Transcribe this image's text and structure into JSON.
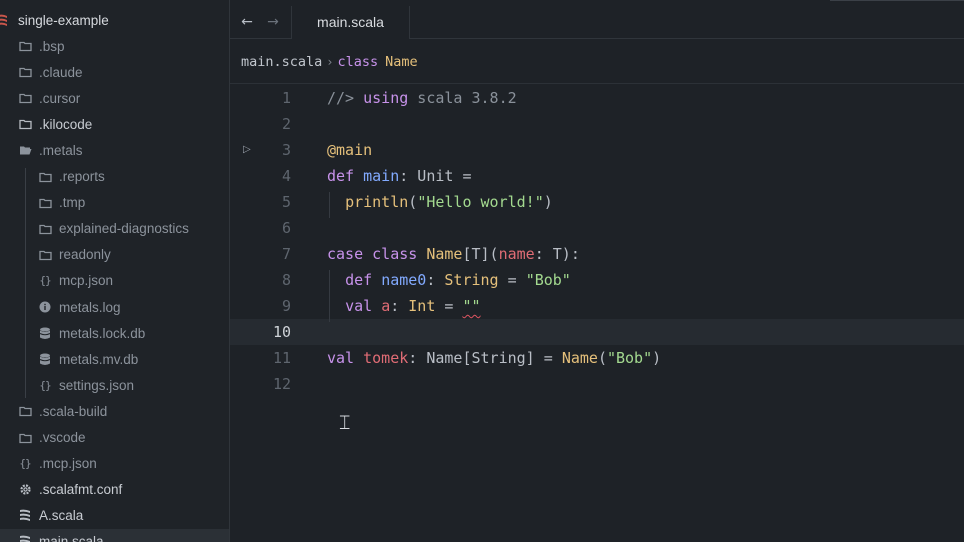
{
  "sidebar": {
    "project": "single-example",
    "items": [
      {
        "label": ".bsp",
        "icon": "folder-icon",
        "level": 1,
        "dim": true
      },
      {
        "label": ".claude",
        "icon": "folder-icon",
        "level": 1,
        "dim": true
      },
      {
        "label": ".cursor",
        "icon": "folder-icon",
        "level": 1,
        "dim": true
      },
      {
        "label": ".kilocode",
        "icon": "folder-icon",
        "level": 1,
        "dim": false
      },
      {
        "label": ".metals",
        "icon": "folder-open-icon",
        "level": 1,
        "dim": true
      },
      {
        "label": ".reports",
        "icon": "folder-icon",
        "level": 2,
        "dim": true
      },
      {
        "label": ".tmp",
        "icon": "folder-icon",
        "level": 2,
        "dim": true
      },
      {
        "label": "explained-diagnostics",
        "icon": "folder-icon",
        "level": 2,
        "dim": true
      },
      {
        "label": "readonly",
        "icon": "folder-icon",
        "level": 2,
        "dim": true
      },
      {
        "label": "mcp.json",
        "icon": "json-icon",
        "level": 2,
        "dim": true
      },
      {
        "label": "metals.log",
        "icon": "info-icon",
        "level": 2,
        "dim": true
      },
      {
        "label": "metals.lock.db",
        "icon": "database-icon",
        "level": 2,
        "dim": true
      },
      {
        "label": "metals.mv.db",
        "icon": "database-icon",
        "level": 2,
        "dim": true
      },
      {
        "label": "settings.json",
        "icon": "json-icon",
        "level": 2,
        "dim": true
      },
      {
        "label": ".scala-build",
        "icon": "folder-icon",
        "level": 1,
        "dim": true
      },
      {
        "label": ".vscode",
        "icon": "folder-icon",
        "level": 1,
        "dim": true
      },
      {
        "label": ".mcp.json",
        "icon": "json-icon",
        "level": 1,
        "dim": true
      },
      {
        "label": ".scalafmt.conf",
        "icon": "gear-icon",
        "level": 1,
        "dim": false
      },
      {
        "label": "A.scala",
        "icon": "scala-icon",
        "level": 1,
        "dim": false
      },
      {
        "label": "main.scala",
        "icon": "scala-icon",
        "level": 1,
        "dim": false,
        "active": true
      }
    ]
  },
  "tabs": [
    {
      "label": "main.scala",
      "active": true
    }
  ],
  "nav": {
    "back": "←",
    "forward": "→"
  },
  "breadcrumb": {
    "file": "main.scala",
    "separator": "›",
    "kind": "class",
    "symbol": "Name"
  },
  "editor": {
    "current_line": 10,
    "lines": [
      {
        "n": "1",
        "tokens": [
          {
            "t": "//> ",
            "c": "cm"
          },
          {
            "t": "using",
            "c": "kw"
          },
          {
            "t": " scala 3.8.2",
            "c": "cm"
          }
        ]
      },
      {
        "n": "2",
        "tokens": []
      },
      {
        "n": "3",
        "run": "▷",
        "tokens": [
          {
            "t": "@main",
            "c": "an"
          }
        ]
      },
      {
        "n": "4",
        "tokens": [
          {
            "t": "def",
            "c": "kw"
          },
          {
            "t": " "
          },
          {
            "t": "main",
            "c": "fn"
          },
          {
            "t": ": Unit ="
          }
        ]
      },
      {
        "n": "5",
        "tokens": [
          {
            "t": "  "
          },
          {
            "t": "println",
            "c": "ty"
          },
          {
            "t": "("
          },
          {
            "t": "\"Hello world!\"",
            "c": "st"
          },
          {
            "t": ")"
          }
        ]
      },
      {
        "n": "6",
        "tokens": []
      },
      {
        "n": "7",
        "tokens": [
          {
            "t": "case",
            "c": "kw"
          },
          {
            "t": " "
          },
          {
            "t": "class",
            "c": "kw"
          },
          {
            "t": " "
          },
          {
            "t": "Name",
            "c": "ty"
          },
          {
            "t": "[T]("
          },
          {
            "t": "name",
            "c": "pm"
          },
          {
            "t": ": T):"
          }
        ]
      },
      {
        "n": "8",
        "tokens": [
          {
            "t": "  "
          },
          {
            "t": "def",
            "c": "kw"
          },
          {
            "t": " "
          },
          {
            "t": "name0",
            "c": "fn"
          },
          {
            "t": ": "
          },
          {
            "t": "String",
            "c": "ty"
          },
          {
            "t": " = "
          },
          {
            "t": "\"Bob\"",
            "c": "st"
          }
        ]
      },
      {
        "n": "9",
        "tokens": [
          {
            "t": "  "
          },
          {
            "t": "val",
            "c": "kw"
          },
          {
            "t": " "
          },
          {
            "t": "a",
            "c": "pm"
          },
          {
            "t": ": "
          },
          {
            "t": "Int",
            "c": "ty"
          },
          {
            "t": " = "
          },
          {
            "t": "\"\"",
            "c": "st err"
          }
        ]
      },
      {
        "n": "10",
        "tokens": []
      },
      {
        "n": "11",
        "tokens": [
          {
            "t": "val",
            "c": "kw"
          },
          {
            "t": " "
          },
          {
            "t": "tomek",
            "c": "pm"
          },
          {
            "t": ": Name[String] = "
          },
          {
            "t": "Name",
            "c": "ty"
          },
          {
            "t": "("
          },
          {
            "t": "\"Bob\"",
            "c": "st"
          },
          {
            "t": ")"
          }
        ]
      },
      {
        "n": "12",
        "tokens": []
      }
    ]
  },
  "colors": {
    "background": "#1e2227",
    "sidebar": "#1f2328",
    "keyword": "#c792ea",
    "string": "#a3d98f",
    "type": "#e5c07b",
    "error": "#e05561"
  }
}
